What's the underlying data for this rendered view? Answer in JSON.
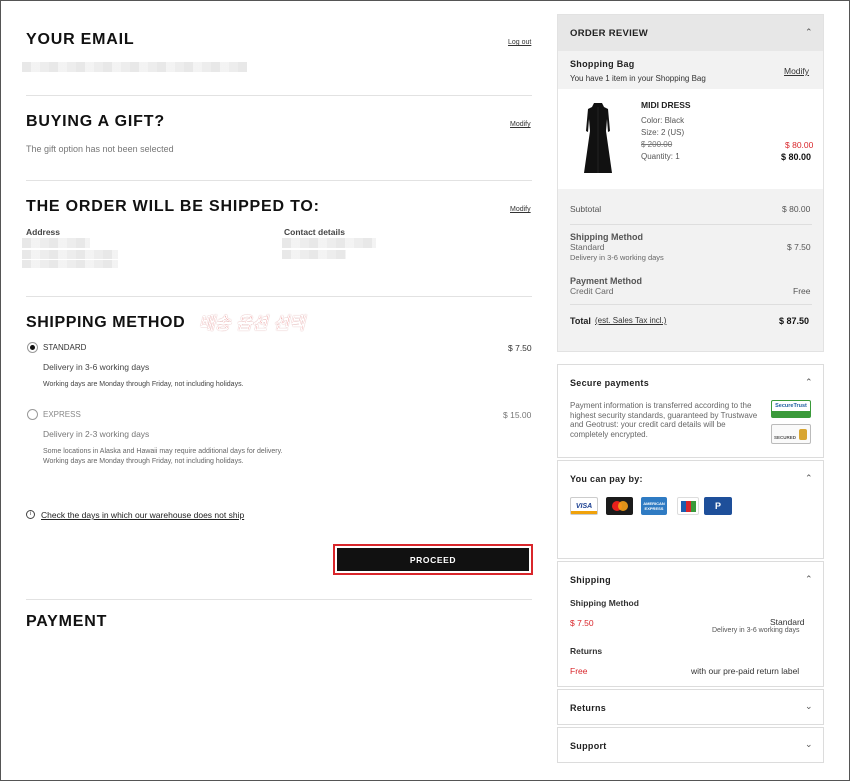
{
  "email": {
    "title": "YOUR EMAIL",
    "logout_label": "Log out"
  },
  "gift": {
    "title": "BUYING A GIFT?",
    "modify_label": "Modify",
    "status": "The gift option has not been selected"
  },
  "shipping_to": {
    "title": "THE ORDER WILL BE SHIPPED TO:",
    "modify_label": "Modify",
    "address_label": "Address",
    "contact_label": "Contact details"
  },
  "shipping_method": {
    "title": "SHIPPING METHOD",
    "annotation": "배송 옵션 선택",
    "options": [
      {
        "name": "STANDARD",
        "price": "$ 7.50",
        "delivery": "Delivery in 3-6 working days",
        "note1": "Working days are Monday through Friday, not including holidays.",
        "note2": "",
        "selected": true
      },
      {
        "name": "EXPRESS",
        "price": "$ 15.00",
        "delivery": "Delivery in 2-3 working days",
        "note1": "Some locations in Alaska and Hawaii may require additional days for delivery.",
        "note2": "Working days are Monday through Friday, not including holidays.",
        "selected": false
      }
    ],
    "warehouse_link": "Check the days in which our warehouse does not ship",
    "proceed_label": "PROCEED"
  },
  "payment": {
    "title": "PAYMENT"
  },
  "order_review": {
    "title": "ORDER REVIEW",
    "bag_title": "Shopping Bag",
    "bag_count": "You have 1 item in your Shopping Bag",
    "modify_label": "Modify",
    "item": {
      "name": "MIDI DRESS",
      "color": "Color: Black",
      "size": "Size: 2 (US)",
      "original_price": "$ 200.00",
      "quantity": "Quantity: 1",
      "sale_price": "$ 80.00",
      "total_price": "$ 80.00"
    },
    "subtotal_label": "Subtotal",
    "subtotal_value": "$ 80.00",
    "shipping_label": "Shipping Method",
    "shipping_name": "Standard",
    "shipping_delivery": "Delivery in 3-6 working days",
    "shipping_value": "$ 7.50",
    "payment_label": "Payment Method",
    "payment_name": "Credit Card",
    "payment_value": "Free",
    "total_label": "Total",
    "tax_link": "(est. Sales Tax incl.)",
    "total_value": "$ 87.50"
  },
  "secure": {
    "title": "Secure payments",
    "text": "Payment information is transferred according to the highest security standards, guaranteed by Trustwave and Geotrust: your credit card details will be completely encrypted.",
    "badge1": "SecureTrust",
    "badge2": "SECURED"
  },
  "pay_by": {
    "title": "You can pay by:",
    "cards": [
      "VISA",
      "mastercard",
      "AMERICAN EXPRESS",
      "JCB",
      "PayPal"
    ]
  },
  "shipping_panel": {
    "title": "Shipping",
    "method_label": "Shipping Method",
    "price": "$ 7.50",
    "name": "Standard",
    "delivery": "Delivery in 3-6 working days",
    "returns_label": "Returns",
    "returns_price": "Free",
    "returns_text": "with our pre-paid return label"
  },
  "returns_panel": {
    "title": "Returns"
  },
  "support_panel": {
    "title": "Support"
  },
  "colors": {
    "accent_red": "#d9262b",
    "button_black": "#111111",
    "panel_gray": "#f2f2f2"
  }
}
